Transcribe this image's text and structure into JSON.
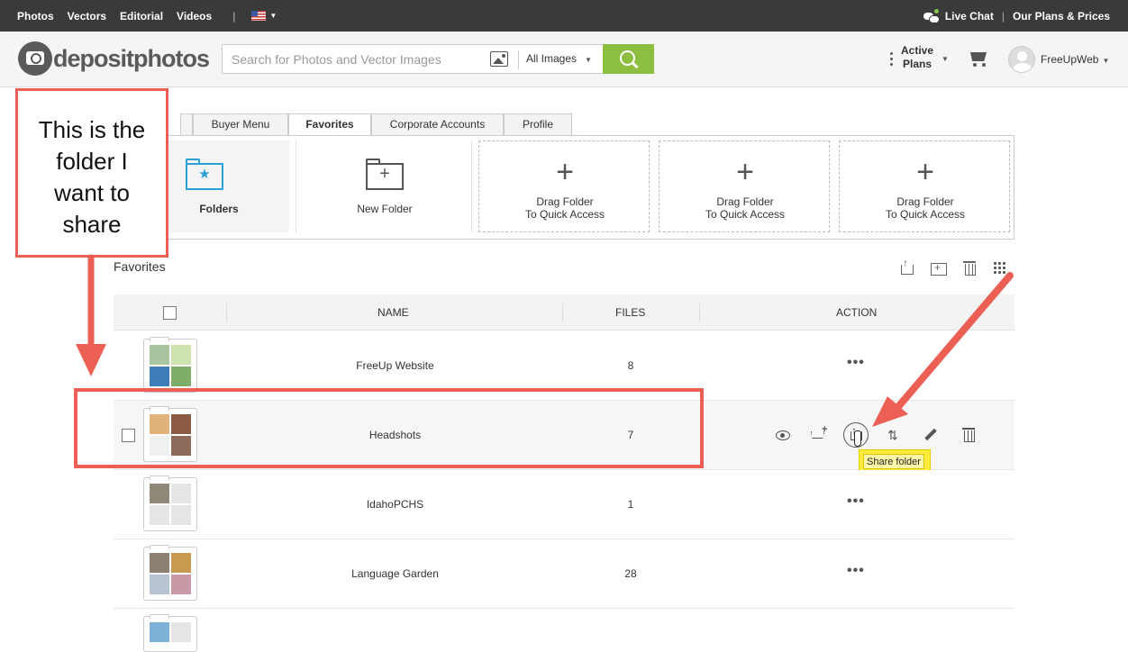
{
  "topbar": {
    "nav": [
      "Photos",
      "Vectors",
      "Editorial",
      "Videos"
    ],
    "separator": "|",
    "live_chat": "Live Chat",
    "divider": "|",
    "plans_prices": "Our Plans & Prices"
  },
  "header": {
    "logo_text": "depositphotos",
    "search_placeholder": "Search for Photos and Vector Images",
    "search_value": "",
    "image_type": "All Images",
    "active_plans_line1": "Active",
    "active_plans_line2": "Plans",
    "username": "FreeUpWeb"
  },
  "tabs": [
    "",
    "Buyer Menu",
    "Favorites",
    "Corporate Accounts",
    "Profile"
  ],
  "active_tab": "Favorites",
  "quick_access": {
    "folders_label": "Folders",
    "new_folder_label": "New Folder",
    "drop_line1": "Drag Folder",
    "drop_line2": "To Quick Access"
  },
  "favorites": {
    "title": "Favorites",
    "columns": {
      "name": "NAME",
      "files": "FILES",
      "action": "ACTION"
    },
    "rows": [
      {
        "name": "FreeUp Website",
        "files": "8"
      },
      {
        "name": "Headshots",
        "files": "7"
      },
      {
        "name": "IdahoPCHS",
        "files": "1"
      },
      {
        "name": "Language Garden",
        "files": "28"
      }
    ],
    "more_actions": "•••",
    "move_glyph": "⇅",
    "tooltip": "Share folder"
  },
  "annotation": {
    "callout_lines": [
      "This is the",
      "folder I",
      "want to",
      "share"
    ],
    "color": "#ec5f55"
  },
  "colors": {
    "topbar_bg": "#3a3a3a",
    "search_button": "#8cbf3f",
    "folder_icon": "#2aa0d4",
    "tooltip_bg": "#ffeb3b"
  }
}
